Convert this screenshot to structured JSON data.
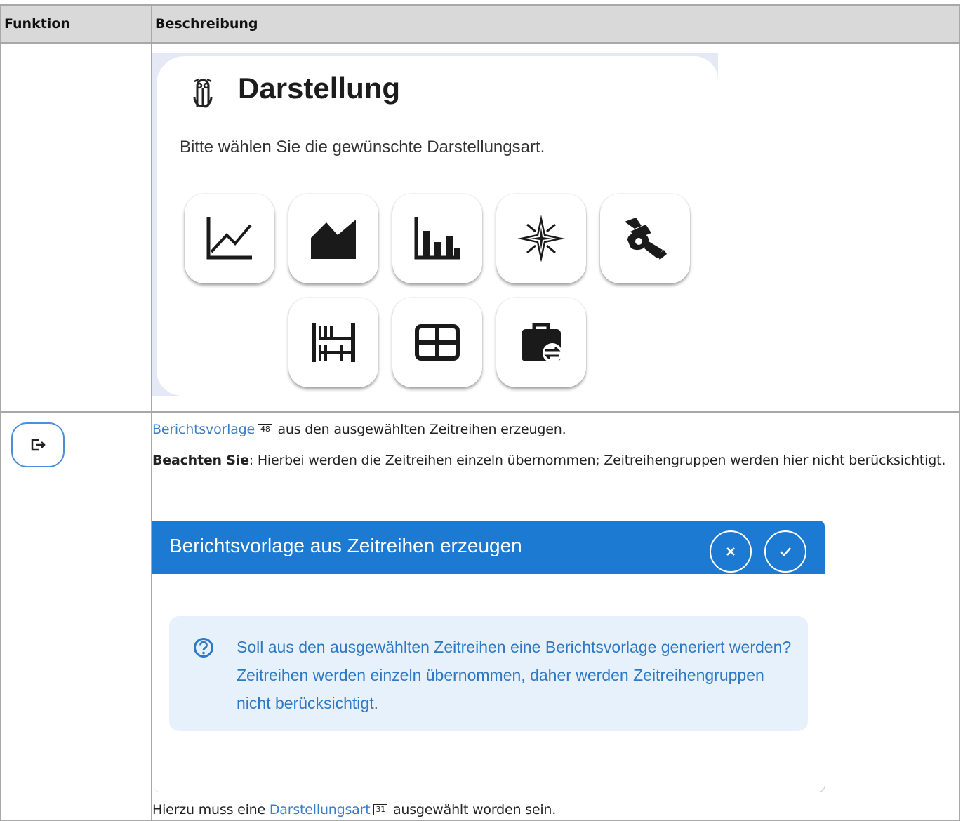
{
  "table": {
    "header_function": "Funktion",
    "header_description": "Beschreibung"
  },
  "darstellung_card": {
    "title": "Darstellung",
    "subtitle": "Bitte wählen Sie die gewünschte Darstellungsart.",
    "tiles": [
      "line-chart-icon",
      "area-chart-icon",
      "bar-chart-icon",
      "compass-rose-icon",
      "hand-sign-icon",
      "abacus-icon",
      "table-grid-icon",
      "briefcase-swap-icon"
    ]
  },
  "row2": {
    "link1": "Berichtsvorlage",
    "ref1": "48",
    "text1": " aus den ausgewählten Zeitreihen erzeugen.",
    "note_bold": "Beachten Sie",
    "note_text": ": Hierbei werden die Zeitreihen einzeln übernommen; Zeitreihengruppen werden hier nicht berücksichtigt.",
    "dialog_title": "Berichtsvorlage aus Zeitreihen erzeugen",
    "dialog_message": "Soll aus den ausgewählten Zeitreihen eine Berichtsvorlage generiert werden? Zeitreihen werden einzeln übernommen, daher werden Zeitreihengruppen nicht berücksichtigt.",
    "footer_prefix": "Hierzu muss eine ",
    "link2": "Darstellungsart",
    "ref2": "31",
    "footer_suffix": " ausgewählt worden sein."
  },
  "colors": {
    "dialog_header": "#1d7ad3",
    "info_bg": "#e6f1fc",
    "info_text": "#2f79c4",
    "link": "#3b7cc9"
  }
}
